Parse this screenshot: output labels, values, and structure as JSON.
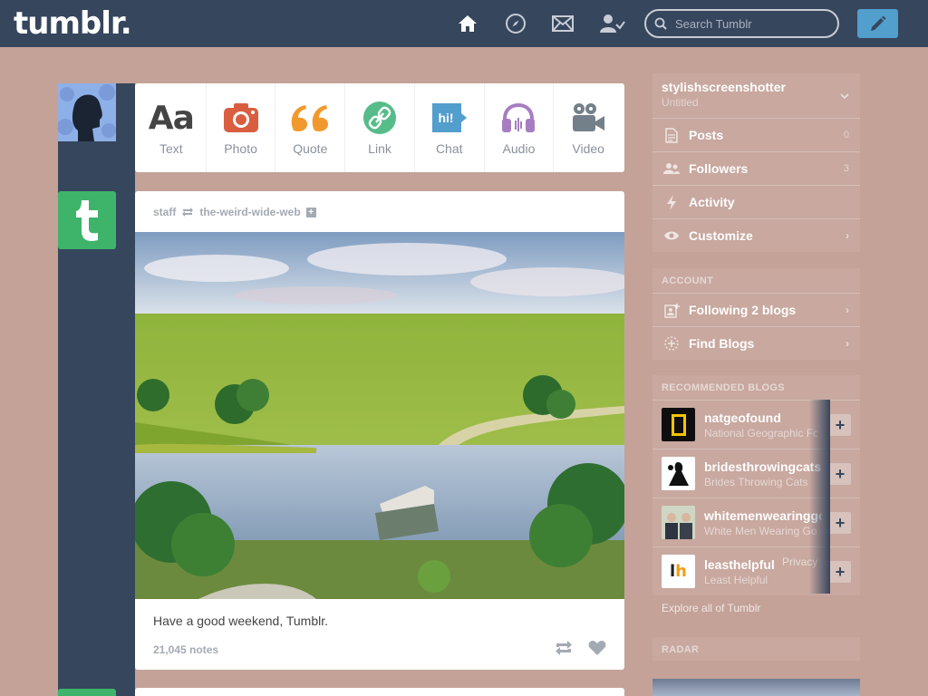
{
  "header": {
    "logo": "tumblr.",
    "search_placeholder": "Search Tumblr",
    "nav": [
      "home-icon",
      "explore-icon",
      "inbox-icon",
      "account-icon"
    ]
  },
  "post_types": [
    {
      "label": "Text",
      "glyph": "Aa",
      "color": "#444444"
    },
    {
      "label": "Photo",
      "color": "#d95e40"
    },
    {
      "label": "Quote",
      "glyph": "66",
      "color": "#f2992e"
    },
    {
      "label": "Link",
      "color": "#56bc8a"
    },
    {
      "label": "Chat",
      "glyph": "hi!",
      "color": "#529ecc"
    },
    {
      "label": "Audio",
      "color": "#a77dc2"
    },
    {
      "label": "Video",
      "color": "#748089"
    }
  ],
  "post": {
    "author": "staff",
    "reblog_from": "the-weird-wide-web",
    "caption": "Have a good weekend, Tumblr.",
    "notes": "21,045 notes"
  },
  "sidebar": {
    "blog": {
      "name": "stylishscreenshotter",
      "title": "Untitled"
    },
    "menu": [
      {
        "label": "Posts",
        "count": "0"
      },
      {
        "label": "Followers",
        "count": "3"
      },
      {
        "label": "Activity"
      },
      {
        "label": "Customize"
      }
    ],
    "account_header": "ACCOUNT",
    "account": [
      {
        "label": "Following 2 blogs"
      },
      {
        "label": "Find Blogs"
      }
    ],
    "recommended_header": "RECOMMENDED BLOGS",
    "recommended": [
      {
        "name": "natgeofound",
        "title": "National Geographic Fou"
      },
      {
        "name": "bridesthrowingcats",
        "title": "Brides Throwing Cats"
      },
      {
        "name": "whitemenwearinggoogleglass",
        "title": "White Men Wearing Go"
      },
      {
        "name": "leasthelpful",
        "title": "Least Helpful"
      }
    ],
    "overlay_text": "Privacy",
    "explore": "Explore all of Tumblr",
    "radar_header": "RADAR"
  }
}
